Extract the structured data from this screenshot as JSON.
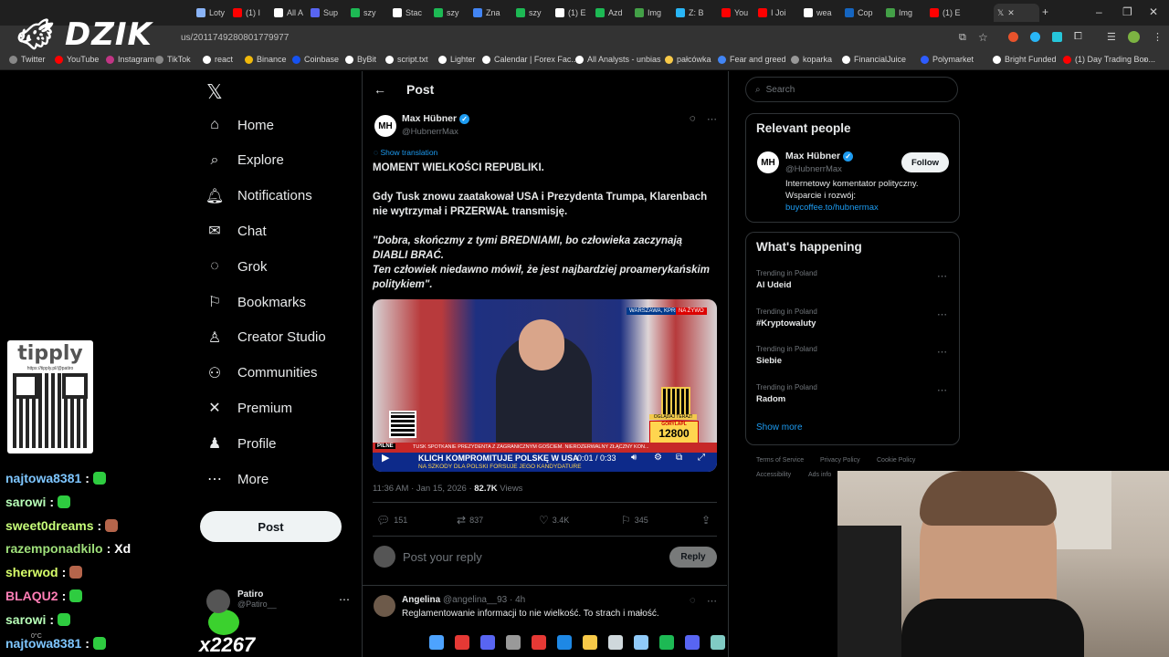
{
  "browser": {
    "tabs": [
      {
        "label": "Loty",
        "color": "#8ab4f8"
      },
      {
        "label": "(1) I",
        "color": "#ff0000"
      },
      {
        "label": "All A",
        "color": "#ffffff"
      },
      {
        "label": "Sup",
        "color": "#5865f2"
      },
      {
        "label": "szy",
        "color": "#1db954"
      },
      {
        "label": "Stac",
        "color": "#ffffff"
      },
      {
        "label": "szy",
        "color": "#1db954"
      },
      {
        "label": "Zna",
        "color": "#4285f4"
      },
      {
        "label": "szy",
        "color": "#1db954"
      },
      {
        "label": "(1) E",
        "color": "#ffffff"
      },
      {
        "label": "Azd",
        "color": "#1db954"
      },
      {
        "label": "Img",
        "color": "#43a047"
      },
      {
        "label": "Z: B",
        "color": "#29b6f6"
      },
      {
        "label": "You",
        "color": "#ff0000"
      },
      {
        "label": "I Joi",
        "color": "#ff0000"
      },
      {
        "label": "wea",
        "color": "#ffffff"
      },
      {
        "label": "Cop",
        "color": "#1565c0"
      },
      {
        "label": "Img",
        "color": "#43a047"
      },
      {
        "label": "(1) E",
        "color": "#ff0000"
      }
    ],
    "url": "us/2011749280801779977",
    "bookmarks": [
      {
        "label": "Twitter",
        "color": "#888"
      },
      {
        "label": "YouTube",
        "color": "#ff0000"
      },
      {
        "label": "Instagram",
        "color": "#c13584"
      },
      {
        "label": "TikTok",
        "color": "#888"
      },
      {
        "label": "react",
        "color": "#fff"
      },
      {
        "label": "Binance",
        "color": "#f0b90b"
      },
      {
        "label": "Coinbase",
        "color": "#1652f0"
      },
      {
        "label": "ByBit",
        "color": "#fff"
      },
      {
        "label": "script.txt",
        "color": "#fff"
      },
      {
        "label": "Lighter",
        "color": "#fff"
      },
      {
        "label": "Calendar | Forex Fac...",
        "color": "#fff"
      },
      {
        "label": "All Analysts - unbias",
        "color": "#fff"
      },
      {
        "label": "pałcówka",
        "color": "#f7c948"
      },
      {
        "label": "Fear and greed",
        "color": "#4285f4"
      },
      {
        "label": "koparka",
        "color": "#999"
      },
      {
        "label": "FinancialJuice",
        "color": "#fff"
      },
      {
        "label": "Polymarket",
        "color": "#2e5cff"
      },
      {
        "label": "Bright Funded",
        "color": "#fff"
      },
      {
        "label": "(1) Day Trading Boo...",
        "color": "#ff0000"
      }
    ]
  },
  "overlay": {
    "logo": "DZIK",
    "tipply_brand": "tipply",
    "tipply_url": "https://tipply.pl/@patiro",
    "counter": "x2267",
    "chat": [
      {
        "user": "najtowa8381",
        "color": "#7ec6ff",
        "msg": "",
        "emote": "#2ecc40"
      },
      {
        "user": "sarowi",
        "color": "#b8ffb8",
        "msg": "",
        "emote": "#2ecc40"
      },
      {
        "user": "sweet0dreams",
        "color": "#c8ff7a",
        "msg": "",
        "emote": "#b5654b"
      },
      {
        "user": "razemponadkilo",
        "color": "#9fe07a",
        "msg": "Xd",
        "emote": ""
      },
      {
        "user": "sherwod",
        "color": "#d8ff6a",
        "msg": "",
        "emote": "#b5654b"
      },
      {
        "user": "BLAQU2",
        "color": "#ff7eb6",
        "msg": "",
        "emote": "#2ecc40"
      },
      {
        "user": "sarowi",
        "color": "#b8ffb8",
        "msg": "",
        "emote": "#2ecc40"
      },
      {
        "user": "najtowa8381",
        "color": "#7ec6ff",
        "msg": "",
        "emote": "#2ecc40"
      }
    ]
  },
  "x": {
    "nav": [
      {
        "label": "Home",
        "icon": "home-icon",
        "glyph": "⌂"
      },
      {
        "label": "Explore",
        "icon": "search-icon",
        "glyph": "⌕"
      },
      {
        "label": "Notifications",
        "icon": "bell-icon",
        "glyph": "🔔︎"
      },
      {
        "label": "Chat",
        "icon": "mail-icon",
        "glyph": "✉"
      },
      {
        "label": "Grok",
        "icon": "grok-icon",
        "glyph": "◌"
      },
      {
        "label": "Bookmarks",
        "icon": "bookmark-icon",
        "glyph": "⚐"
      },
      {
        "label": "Creator Studio",
        "icon": "creator-icon",
        "glyph": "♙"
      },
      {
        "label": "Communities",
        "icon": "communities-icon",
        "glyph": "⚇"
      },
      {
        "label": "Premium",
        "icon": "x-icon",
        "glyph": "✕"
      },
      {
        "label": "Profile",
        "icon": "user-icon",
        "glyph": "♟"
      },
      {
        "label": "More",
        "icon": "more-icon",
        "glyph": "⋯"
      }
    ],
    "post_button": "Post",
    "account": {
      "name": "Patiro",
      "handle": "@Patiro__"
    },
    "header_title": "Post",
    "tweet": {
      "author": "Max Hübner",
      "handle": "@HubnerrMax",
      "avatar": "MH",
      "show_translation": "Show translation",
      "line1": "MOMENT WIELKOŚCI REPUBLIKI.",
      "para2": "Gdy Tusk znowu zaatakował USA i Prezydenta Trumpa, Klarenbach nie wytrzymał i PRZERWAŁ transmisję.",
      "quote1": "\"Dobra, skończmy z tymi BREDNIAMI, bo człowieka zaczynają DIABLI BRAĆ.",
      "quote2": "Ten człowiek niedawno mówił, że jest najbardziej proamerykańskim politykiem\".",
      "timestamp": "11:36 AM · Jan 15, 2026 · ",
      "views": "82.7K",
      "views_label": " Views",
      "replies": "151",
      "reposts": "837",
      "likes": "3.4K",
      "bookmarks": "345"
    },
    "video": {
      "location": "WARSZAWA, KPRM",
      "live": "NA ŻYWO",
      "banner_tag": "PILNE",
      "banner_top": "TUSK SPOTKANIE PREZYDENTA Z ZAGRANICZNYM GOŚCIEM. NIEROZERWALNY ZŁĄCZNY KON...",
      "headline": "KLICH KOMPROMITUJE POLSKĘ W USA",
      "subline": "NA SZKODY DLA POLSKI FORSUJE JEGO KANDYDATURE",
      "sub_label": "GORYLAPL",
      "sub_count": "12800",
      "qr_label": "OGLĄDAJ TERAZ!",
      "time": "0:01 / 0:33"
    },
    "reply_placeholder": "Post your reply",
    "reply_button": "Reply",
    "reply": {
      "name": "Angelina",
      "handle": "@angelina__93 · 4h",
      "text": "Reglamentowanie informacji to nie wielkość. To strach i małość."
    },
    "search_placeholder": "Search",
    "relevant": {
      "title": "Relevant people",
      "name": "Max Hübner",
      "handle": "@HubnerrMax",
      "bio1": "Internetowy komentator polityczny.",
      "bio2": "Wsparcie i rozwój:",
      "link": "buycoffee.to/hubnermax",
      "follow": "Follow"
    },
    "happening": {
      "title": "What's happening",
      "trends": [
        {
          "cat": "Trending in Poland",
          "name": "Al Udeid"
        },
        {
          "cat": "Trending in Poland",
          "name": "#Kryptowaluty"
        },
        {
          "cat": "Trending in Poland",
          "name": "Siebie"
        },
        {
          "cat": "Trending in Poland",
          "name": "Radom"
        }
      ],
      "show_more": "Show more"
    },
    "footer": [
      "Terms of Service",
      "Privacy Policy",
      "Cookie Policy",
      "Accessibility",
      "Ads info"
    ]
  },
  "taskbar": {
    "colors": [
      "#4da3ff",
      "#e53935",
      "#5865f2",
      "#999999",
      "#e53935",
      "#1e88e5",
      "#f7c948",
      "#cfd8dc",
      "#90caf9",
      "#1db954",
      "#5865f2",
      "#80cbc4"
    ],
    "temp": "0°C"
  }
}
